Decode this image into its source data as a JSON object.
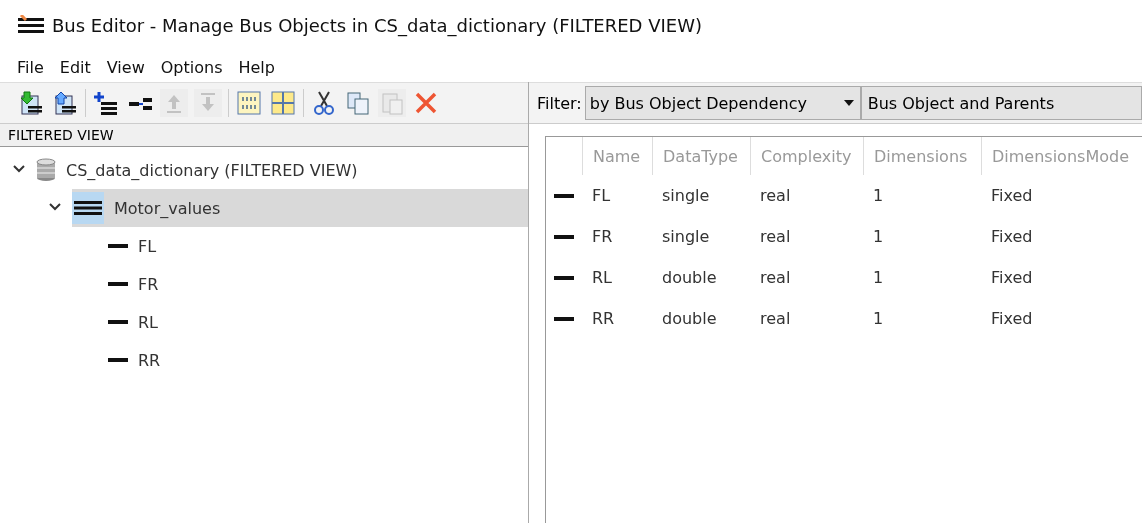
{
  "window": {
    "title": "Bus Editor - Manage Bus Objects in CS_data_dictionary (FILTERED VIEW)"
  },
  "menu": [
    "File",
    "Edit",
    "View",
    "Options",
    "Help"
  ],
  "toolbar": [
    {
      "kind": "import",
      "disabled": false
    },
    {
      "kind": "export",
      "disabled": false
    },
    {
      "kind": "sep"
    },
    {
      "kind": "add-bus",
      "disabled": false
    },
    {
      "kind": "add-element",
      "disabled": false
    },
    {
      "kind": "up",
      "disabled": true
    },
    {
      "kind": "down",
      "disabled": true
    },
    {
      "kind": "sep"
    },
    {
      "kind": "binary",
      "disabled": false
    },
    {
      "kind": "grid",
      "disabled": false
    },
    {
      "kind": "sep"
    },
    {
      "kind": "cut",
      "disabled": false
    },
    {
      "kind": "copy",
      "disabled": false
    },
    {
      "kind": "paste",
      "disabled": true
    },
    {
      "kind": "delete",
      "disabled": false
    }
  ],
  "filter": {
    "label": "Filter:",
    "value": "by Bus Object Dependency",
    "scope": "Bus Object and Parents"
  },
  "tree": {
    "header": "FILTERED VIEW",
    "items": [
      {
        "label": "CS_data_dictionary (FILTERED VIEW)",
        "kind": "dictionary",
        "expanded": true,
        "selected": false,
        "children": [
          {
            "label": "Motor_values",
            "kind": "bus",
            "expanded": true,
            "selected": true,
            "children": [
              {
                "label": "FL",
                "kind": "element",
                "selected": false
              },
              {
                "label": "FR",
                "kind": "element",
                "selected": false
              },
              {
                "label": "RL",
                "kind": "element",
                "selected": false
              },
              {
                "label": "RR",
                "kind": "element",
                "selected": false
              }
            ]
          }
        ]
      }
    ]
  },
  "table": {
    "columns": [
      "Name",
      "DataType",
      "Complexity",
      "Dimensions",
      "DimensionsMode"
    ],
    "rows": [
      [
        "FL",
        "single",
        "real",
        "1",
        "Fixed"
      ],
      [
        "FR",
        "single",
        "real",
        "1",
        "Fixed"
      ],
      [
        "RL",
        "double",
        "real",
        "1",
        "Fixed"
      ],
      [
        "RR",
        "double",
        "real",
        "1",
        "Fixed"
      ]
    ]
  }
}
